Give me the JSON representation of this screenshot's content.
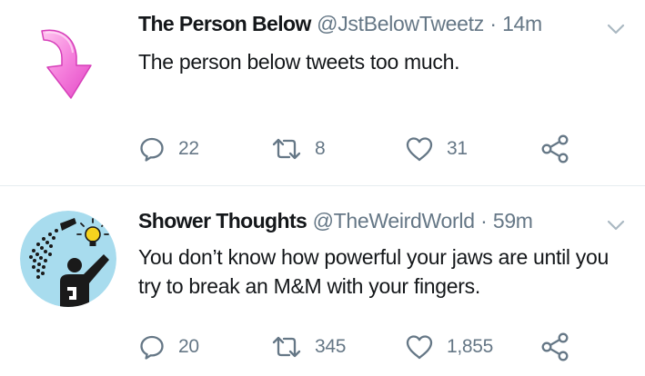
{
  "tweets": [
    {
      "name": "The Person Below",
      "handle": "@JstBelowTweetz",
      "separator": "·",
      "time": "14m",
      "text": "The person below tweets too much.",
      "replies": "22",
      "retweets": "8",
      "likes": "31",
      "avatar_icon": "pink-arrow-down-icon"
    },
    {
      "name": "Shower Thoughts",
      "handle": "@TheWeirdWorld",
      "separator": "·",
      "time": "59m",
      "text": "You don’t know how powerful your jaws are until you try to break an M&M with your fingers.",
      "replies": "20",
      "retweets": "345",
      "likes": "1,855",
      "avatar_icon": "shower-lightbulb-icon"
    }
  ],
  "colors": {
    "text": "#14171a",
    "secondary": "#657786",
    "divider": "#e6ecf0",
    "arrow_pink": "#f06ad6",
    "avatar_bg": "#a8dcee"
  }
}
